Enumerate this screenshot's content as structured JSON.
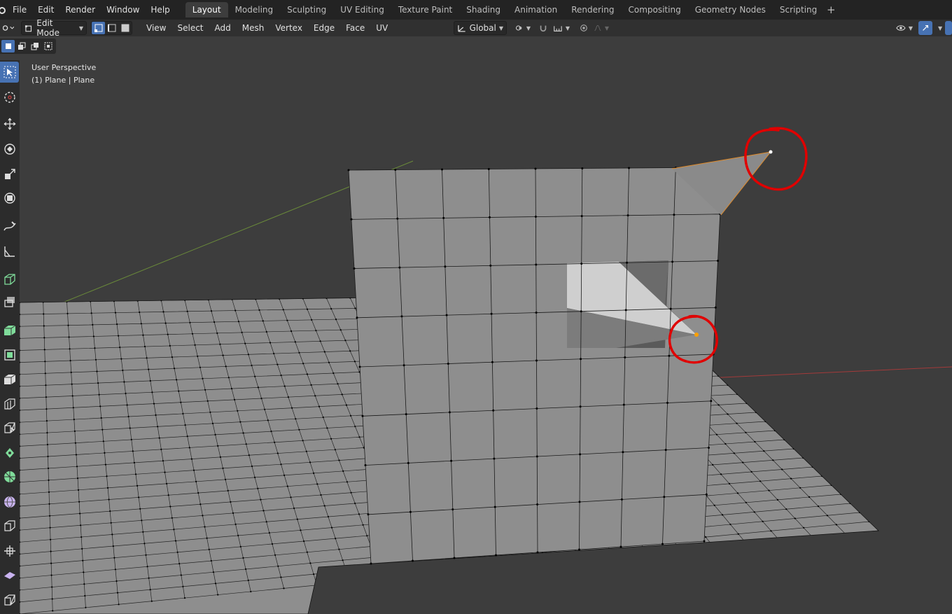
{
  "menubar": {
    "items": [
      "File",
      "Edit",
      "Render",
      "Window",
      "Help"
    ],
    "workspaces": [
      "Layout",
      "Modeling",
      "Sculpting",
      "UV Editing",
      "Texture Paint",
      "Shading",
      "Animation",
      "Rendering",
      "Compositing",
      "Geometry Nodes",
      "Scripting"
    ],
    "active_workspace": "Layout",
    "add_label": "+"
  },
  "header": {
    "mode": "Edit Mode",
    "menus": [
      "View",
      "Select",
      "Add",
      "Mesh",
      "Vertex",
      "Edge",
      "Face",
      "UV"
    ],
    "transform_orientation": "Global"
  },
  "viewport": {
    "perspective_label": "User Perspective",
    "object_label": "(1) Plane | Plane"
  },
  "colors": {
    "background": "#3d3d3d",
    "mesh_face": "#8e8e8e",
    "selected_vertex": "#ffa000",
    "annotation": "#e00000",
    "x_axis": "#a33a3a",
    "y_axis": "#6a8a3a",
    "accent": "#4772b3"
  }
}
